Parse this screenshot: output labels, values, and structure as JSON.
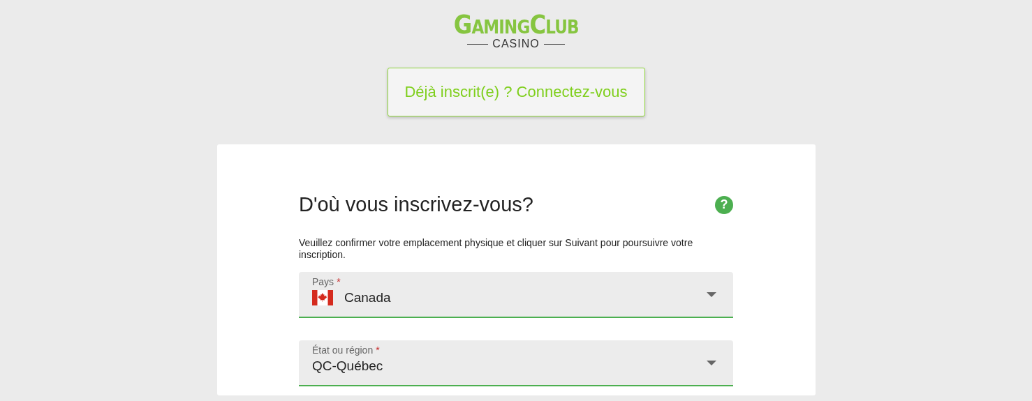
{
  "logo": {
    "name": "GamingClub",
    "subtitle": "CASINO"
  },
  "login_button": {
    "label": "Déjà inscrit(e) ? Connectez-vous"
  },
  "form": {
    "title": "D'où vous inscrivez-vous?",
    "help": "?",
    "description": "Veuillez confirmer votre emplacement physique et cliquer sur Suivant pour poursuivre votre inscription.",
    "fields": [
      {
        "kind": "country",
        "label": "Pays",
        "required_mark": "*",
        "value": "Canada"
      },
      {
        "kind": "select",
        "label": "État ou région",
        "required_mark": "*",
        "value": "QC-Québec"
      }
    ]
  }
}
